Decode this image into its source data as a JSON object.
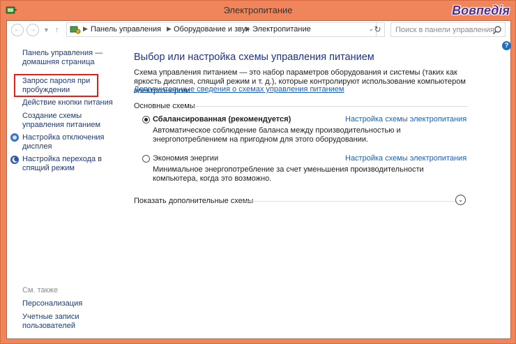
{
  "window": {
    "title": "Электропитание",
    "watermark": "Вовпедія"
  },
  "addressbar": {
    "crumbs": [
      "Панель управления",
      "Оборудование и звук",
      "Электропитание"
    ],
    "search_placeholder": "Поиск в панели управления"
  },
  "sidebar": {
    "items": [
      {
        "label": "Панель управления — домашняя страница"
      },
      {
        "label": "Запрос пароля при пробуждении"
      },
      {
        "label": "Действие кнопки питания"
      },
      {
        "label": "Создание схемы управления питанием"
      },
      {
        "label": "Настройка отключения дисплея"
      },
      {
        "label": "Настройка перехода в спящий режим"
      }
    ],
    "see_also_title": "См. также",
    "see_also": [
      {
        "label": "Персонализация"
      },
      {
        "label": "Учетные записи пользователей"
      }
    ]
  },
  "main": {
    "title": "Выбор или настройка схемы управления питанием",
    "description": "Схема управления питанием — это набор параметров оборудования и системы (таких как яркость дисплея, спящий режим и т. д.), которые контролируют использование компьютером электроэнергии.",
    "more_info_link": "Дополнительные сведения о схемах управления питанием",
    "group_title": "Основные схемы",
    "plans": [
      {
        "name": "Сбалансированная (рекомендуется)",
        "selected": true,
        "link": "Настройка схемы электропитания",
        "desc": "Автоматическое соблюдение баланса между производительностью и энергопотреблением на пригодном для этого оборудовании."
      },
      {
        "name": "Экономия энергии",
        "selected": false,
        "link": "Настройка схемы электропитания",
        "desc": "Минимальное энергопотребление за счет уменьшения производительности компьютера, когда это возможно."
      }
    ],
    "show_more": "Показать дополнительные схемы"
  }
}
